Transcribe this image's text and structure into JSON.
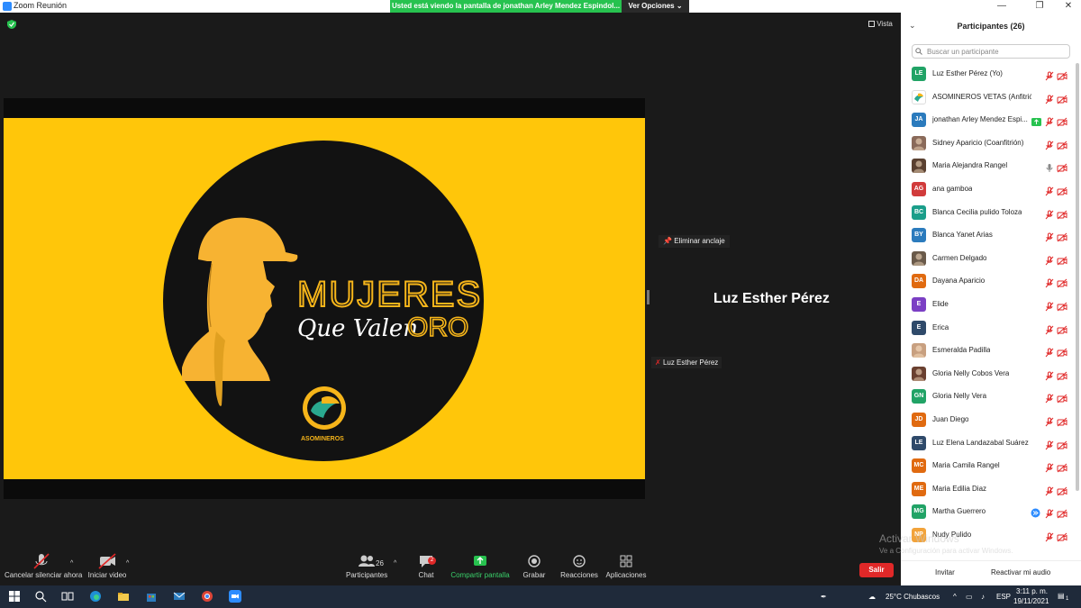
{
  "window": {
    "title": "Zoom Reunión",
    "minimize": "—",
    "maximize": "❐",
    "close": "✕"
  },
  "share_banner": {
    "text": "Usted está viendo la pantalla de jonathan Arley Mendez Espindol...",
    "view_options": "Ver Opciones ⌄"
  },
  "stage": {
    "vista_label": "Vista",
    "slide": {
      "line1": "MUJERES",
      "line2": "Que Valen",
      "line3": "ORO",
      "logo_text": "ASOMINEROS"
    },
    "unpin_label": "Eliminar anclaje",
    "speaker_name": "Luz Esther Pérez",
    "speaker_tag": "Luz Esther Pérez"
  },
  "toolbar": {
    "unmute": "Cancelar silenciar ahora",
    "start_video": "Iniciar video",
    "participants": "Participantes",
    "participants_count": "26",
    "chat": "Chat",
    "chat_badge": "2",
    "share": "Compartir pantalla",
    "record": "Grabar",
    "reactions": "Reacciones",
    "apps": "Aplicaciones",
    "leave": "Salir"
  },
  "panel": {
    "title": "Participantes (26)",
    "search_placeholder": "Buscar un participante",
    "participants": [
      {
        "initials": "LE",
        "color": "#21a366",
        "name": "Luz Esther Pérez (Yo)",
        "mic": "muted"
      },
      {
        "initials": "",
        "color": "#ffffff",
        "name": "ASOMINEROS VETAS (Anfitrión)",
        "mic": "muted",
        "photo": "logo"
      },
      {
        "initials": "JA",
        "color": "#2b7bbd",
        "name": "jonathan Arley Mendez Espi...",
        "mic": "muted",
        "badge": "share"
      },
      {
        "initials": "",
        "color": "#8a6a5a",
        "name": "Sidney Aparicio (Coanfitrión)",
        "mic": "muted",
        "photo": "photo"
      },
      {
        "initials": "",
        "color": "#5a4030",
        "name": "Maria Alejandra Rangel",
        "mic": "on",
        "photo": "photo"
      },
      {
        "initials": "AG",
        "color": "#d13b3b",
        "name": "ana gamboa",
        "mic": "muted"
      },
      {
        "initials": "BC",
        "color": "#1a9e8a",
        "name": "Blanca Cecilia pulido Toloza",
        "mic": "muted"
      },
      {
        "initials": "BY",
        "color": "#2b7bbd",
        "name": "Blanca Yanet Arias",
        "mic": "muted"
      },
      {
        "initials": "",
        "color": "#6a5a4a",
        "name": "Carmen Delgado",
        "mic": "muted",
        "photo": "photo"
      },
      {
        "initials": "DA",
        "color": "#e06a10",
        "name": "Dayana Aparicio",
        "mic": "muted"
      },
      {
        "initials": "E",
        "color": "#7b3fc4",
        "name": "Elide",
        "mic": "muted"
      },
      {
        "initials": "E",
        "color": "#2f4a6a",
        "name": "Erica",
        "mic": "muted"
      },
      {
        "initials": "",
        "color": "#c8a080",
        "name": "Esmeralda Padilla",
        "mic": "muted",
        "photo": "photo"
      },
      {
        "initials": "",
        "color": "#6a4030",
        "name": "Gloria Nelly Cobos Vera",
        "mic": "muted",
        "photo": "photo"
      },
      {
        "initials": "GN",
        "color": "#21a366",
        "name": "Gloria Nelly Vera",
        "mic": "muted"
      },
      {
        "initials": "JD",
        "color": "#e06a10",
        "name": "Juan Diego",
        "mic": "muted"
      },
      {
        "initials": "LE",
        "color": "#2f4a6a",
        "name": "Luz Elena Landazabal Suárez",
        "mic": "muted"
      },
      {
        "initials": "MC",
        "color": "#e06a10",
        "name": "Maria Camila Rangel",
        "mic": "muted"
      },
      {
        "initials": "ME",
        "color": "#e06a10",
        "name": "Maria Edilia Diaz",
        "mic": "muted"
      },
      {
        "initials": "MG",
        "color": "#21a366",
        "name": "Martha Guerrero",
        "mic": "muted",
        "badge": "arrows"
      },
      {
        "initials": "NP",
        "color": "#f2a33a",
        "name": "Nudy Pulido",
        "mic": "muted"
      }
    ],
    "invite": "Invitar",
    "reenable_audio": "Reactivar mi audio"
  },
  "watermark": {
    "line1": "Activar Windows",
    "line2": "Ve a Configuración para activar Windows."
  },
  "taskbar": {
    "weather": "25°C Chubascos",
    "lang": "ESP",
    "time": "3:11 p. m.",
    "date": "19/11/2021",
    "notif_count": "1"
  }
}
